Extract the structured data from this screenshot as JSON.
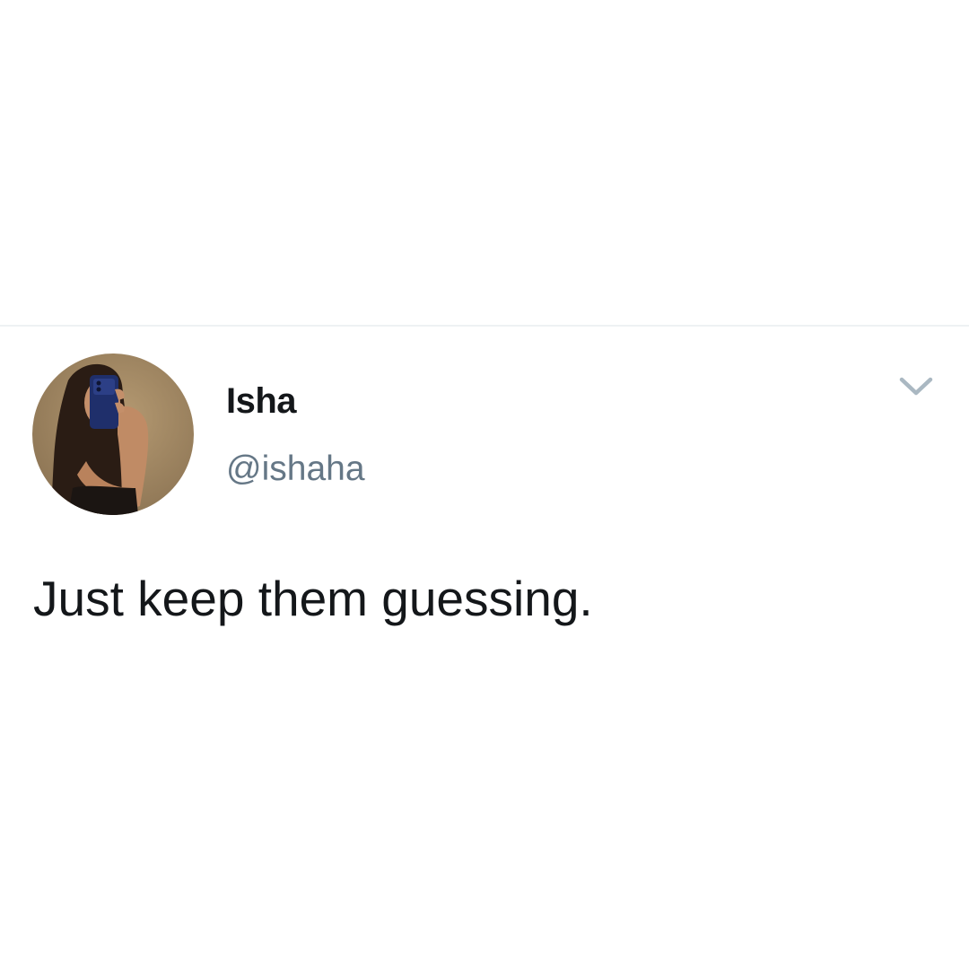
{
  "tweet": {
    "author": {
      "display_name": "Isha",
      "handle": "@ishaha",
      "avatar_icon": "profile-photo"
    },
    "menu_icon": "chevron-down-icon",
    "text": "Just keep them guessing."
  },
  "colors": {
    "background": "#ffffff",
    "divider": "#eef1f3",
    "primary_text": "#14171a",
    "secondary_text": "#657786",
    "chevron": "#aab8c2"
  }
}
